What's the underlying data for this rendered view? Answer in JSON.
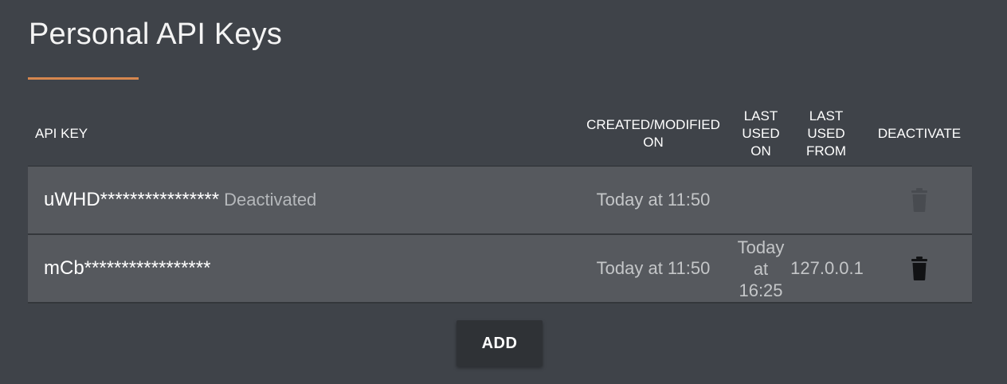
{
  "page": {
    "title": "Personal API Keys",
    "accent_color": "#d6874f"
  },
  "table": {
    "headers": {
      "api_key": "API KEY",
      "created": "CREATED/MODIFIED\nON",
      "last_used_on": "LAST\nUSED\nON",
      "last_used_from": "LAST\nUSED\nFROM",
      "deactivate": "DEACTIVATE"
    },
    "rows": [
      {
        "key": "uWHD****************",
        "status": "Deactivated",
        "created": "Today at 11:50",
        "last_used_on": "",
        "last_used_from": "",
        "delete_icon": "trash-icon-disabled"
      },
      {
        "key": "mCb*****************",
        "status": "",
        "created": "Today at 11:50",
        "last_used_on": "Today\nat\n16:25",
        "last_used_from": "127.0.0.1",
        "delete_icon": "trash-icon"
      }
    ]
  },
  "actions": {
    "add_label": "ADD"
  }
}
